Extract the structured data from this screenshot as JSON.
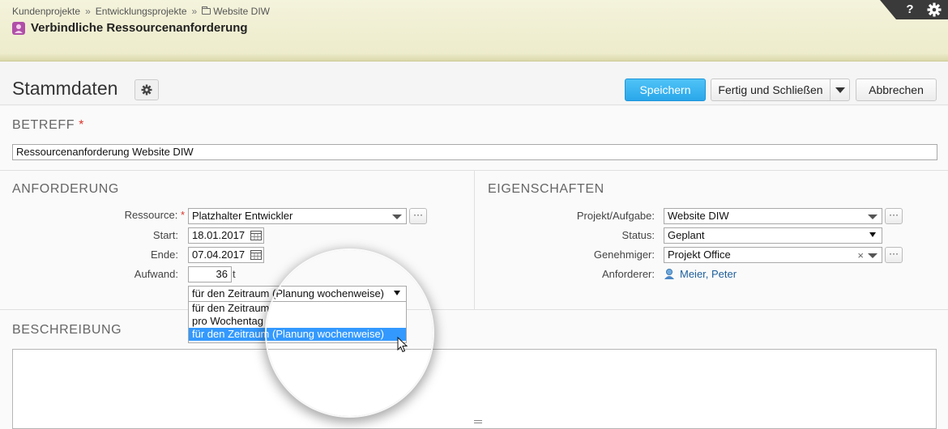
{
  "breadcrumb": {
    "item1": "Kundenprojekte",
    "sep1": "»",
    "item2": "Entwicklungsprojekte",
    "sep2": "»",
    "item3": "Website DIW"
  },
  "page": {
    "title": "Verbindliche Ressourcenanforderung"
  },
  "toolbar": {
    "help_label": "?"
  },
  "section": {
    "title": "Stammdaten",
    "save_label": "Speichern",
    "finish_label": "Fertig und Schließen",
    "cancel_label": "Abbrechen"
  },
  "betreff": {
    "heading": "BETREFF",
    "required_mark": "*",
    "value": "Ressourcenanforderung Website DIW"
  },
  "anforderung": {
    "heading": "ANFORDERUNG",
    "required_mark": "*",
    "ressource_label": "Ressource:",
    "ressource_value": "Platzhalter Entwickler",
    "start_label": "Start:",
    "start_value": "18.01.2017",
    "ende_label": "Ende:",
    "ende_value": "07.04.2017",
    "aufwand_label": "Aufwand:",
    "aufwand_value": "36",
    "aufwand_unit": "t",
    "mode_selected": "für den Zeitraum (Planung wochenweise)",
    "mode_options": [
      "für den Zeitraum",
      "pro Wochentag",
      "für den Zeitraum (Planung wochenweise)"
    ],
    "dots_label": "···"
  },
  "eigenschaften": {
    "heading": "EIGENSCHAFTEN",
    "projekt_label": "Projekt/Aufgabe:",
    "projekt_value": "Website DIW",
    "status_label": "Status:",
    "status_value": "Geplant",
    "genehmiger_label": "Genehmiger:",
    "genehmiger_value": "Projekt Office",
    "anforderer_label": "Anforderer:",
    "anforderer_value": "Meier, Peter",
    "clear_label": "×",
    "dots_label": "···"
  },
  "beschreibung": {
    "heading": "BESCHREIBUNG",
    "value": ""
  },
  "colors": {
    "header_bg": "#f1f0d6",
    "primary_button": "#35b0f0",
    "selection": "#3399ff",
    "required": "#d9342b",
    "link": "#1d5f9c"
  }
}
